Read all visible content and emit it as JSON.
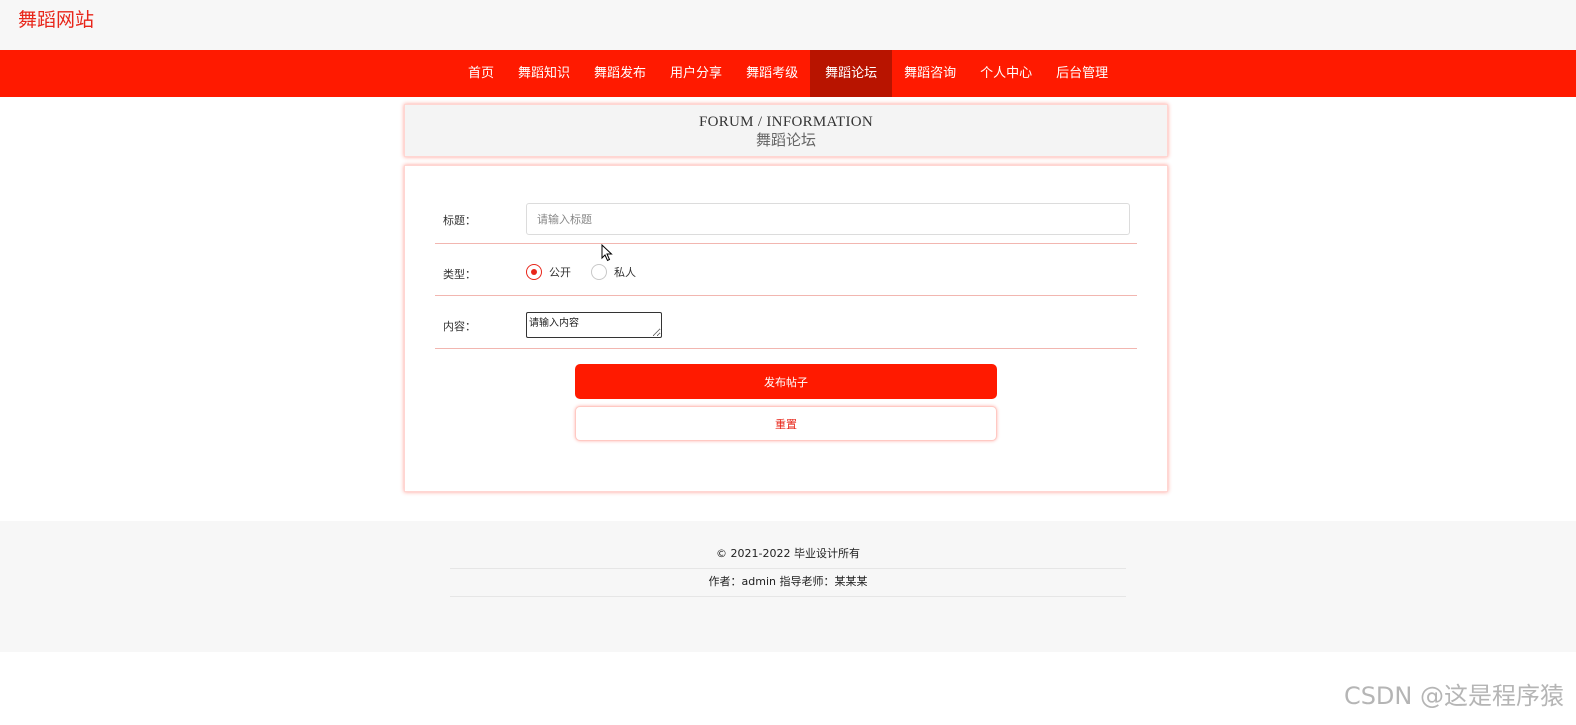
{
  "site": {
    "title": "舞蹈网站"
  },
  "nav": {
    "items": [
      {
        "label": "首页"
      },
      {
        "label": "舞蹈知识"
      },
      {
        "label": "舞蹈发布"
      },
      {
        "label": "用户分享"
      },
      {
        "label": "舞蹈考级"
      },
      {
        "label": "舞蹈论坛",
        "active": true
      },
      {
        "label": "舞蹈咨询"
      },
      {
        "label": "个人中心"
      },
      {
        "label": "后台管理"
      }
    ]
  },
  "section": {
    "title_en": "FORUM / INFORMATION",
    "title_cn": "舞蹈论坛"
  },
  "form": {
    "title_label": "标题：",
    "title_placeholder": "请输入标题",
    "title_value": "",
    "type_label": "类型：",
    "type_options": [
      {
        "label": "公开",
        "checked": true
      },
      {
        "label": "私人",
        "checked": false
      }
    ],
    "content_label": "内容：",
    "content_placeholder": "请输入内容",
    "submit_label": "发布帖子",
    "reset_label": "重置"
  },
  "footer": {
    "copyright": "© 2021-2022 毕业设计所有",
    "author": "作者：admin 指导老师：某某某"
  },
  "watermark": "CSDN @这是程序猿",
  "colors": {
    "accent": "#ff1a00",
    "nav_active": "#b81400",
    "site_title": "#e8261a"
  }
}
